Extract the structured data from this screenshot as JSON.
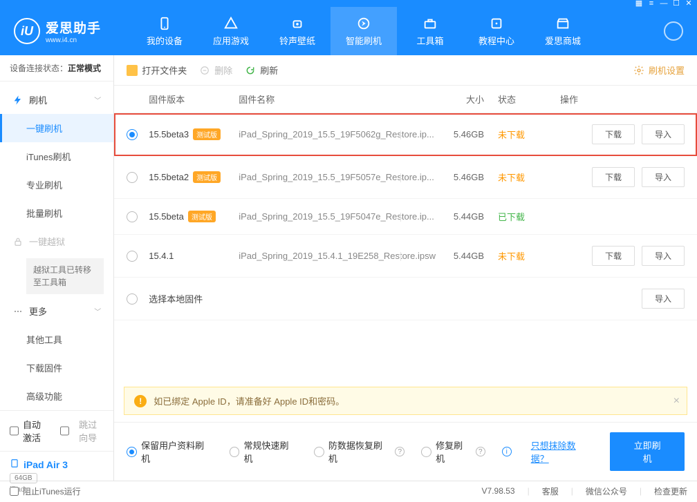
{
  "titlebar": {
    "icons": [
      "grid",
      "menu",
      "min",
      "max",
      "close"
    ]
  },
  "logo": {
    "title": "爱思助手",
    "sub": "www.i4.cn",
    "glyph": "iU"
  },
  "topnav": [
    {
      "id": "device",
      "label": "我的设备"
    },
    {
      "id": "apps",
      "label": "应用游戏"
    },
    {
      "id": "ringtone",
      "label": "铃声壁纸"
    },
    {
      "id": "flash",
      "label": "智能刷机",
      "active": true
    },
    {
      "id": "toolbox",
      "label": "工具箱"
    },
    {
      "id": "tutorial",
      "label": "教程中心"
    },
    {
      "id": "store",
      "label": "爱思商城"
    }
  ],
  "connection": {
    "label": "设备连接状态：",
    "value": "正常模式"
  },
  "sidebar": {
    "groups": [
      {
        "icon": "flash",
        "label": "刷机",
        "expanded": true,
        "items": [
          {
            "id": "oneclick",
            "label": "一键刷机",
            "selected": true
          },
          {
            "id": "itunes",
            "label": "iTunes刷机"
          },
          {
            "id": "pro",
            "label": "专业刷机"
          },
          {
            "id": "batch",
            "label": "批量刷机"
          }
        ]
      },
      {
        "icon": "lock",
        "label": "一键越狱",
        "disabled": true,
        "note": "越狱工具已转移至工具箱"
      },
      {
        "icon": "more",
        "label": "更多",
        "expanded": true,
        "items": [
          {
            "id": "othertools",
            "label": "其他工具"
          },
          {
            "id": "dlfw",
            "label": "下载固件"
          },
          {
            "id": "adv",
            "label": "高级功能"
          }
        ]
      }
    ],
    "autoActivate": {
      "label": "自动激活",
      "checked": false,
      "hint": "跳过向导",
      "hintChecked": false
    },
    "device": {
      "name": "iPad Air 3",
      "capacity": "64GB",
      "model": "iPad",
      "iconColor": "#1a8cff"
    }
  },
  "toolbar": {
    "openFolder": "打开文件夹",
    "delete": "删除",
    "refresh": "刷新",
    "settings": "刷机设置"
  },
  "table": {
    "headers": {
      "version": "固件版本",
      "name": "固件名称",
      "size": "大小",
      "status": "状态",
      "ops": "操作"
    },
    "rows": [
      {
        "selected": true,
        "highlight": true,
        "version": "15.5beta3",
        "beta": "测试版",
        "file": "iPad_Spring_2019_15.5_19F5062g_Restore.ip...",
        "size": "5.46GB",
        "status": "未下载",
        "statusClass": "nd",
        "download": "下载",
        "import": "导入"
      },
      {
        "selected": false,
        "version": "15.5beta2",
        "beta": "测试版",
        "file": "iPad_Spring_2019_15.5_19F5057e_Restore.ip...",
        "size": "5.46GB",
        "status": "未下载",
        "statusClass": "nd",
        "download": "下载",
        "import": "导入"
      },
      {
        "selected": false,
        "version": "15.5beta",
        "beta": "测试版",
        "file": "iPad_Spring_2019_15.5_19F5047e_Restore.ip...",
        "size": "5.44GB",
        "status": "已下载",
        "statusClass": "dl"
      },
      {
        "selected": false,
        "version": "15.4.1",
        "file": "iPad_Spring_2019_15.4.1_19E258_Restore.ipsw",
        "size": "5.44GB",
        "status": "未下载",
        "statusClass": "nd",
        "download": "下载",
        "import": "导入"
      },
      {
        "selected": false,
        "version": "选择本地固件",
        "localRow": true,
        "import": "导入"
      }
    ]
  },
  "notice": "如已绑定 Apple ID，请准备好 Apple ID和密码。",
  "flashOptions": [
    {
      "id": "keepdata",
      "label": "保留用户资料刷机",
      "checked": true
    },
    {
      "id": "quick",
      "label": "常规快速刷机"
    },
    {
      "id": "recover",
      "label": "防数据恢复刷机",
      "help": true
    },
    {
      "id": "repair",
      "label": "修复刷机",
      "help": true
    }
  ],
  "eraseLink": "只想抹除数据？",
  "flashButton": "立即刷机",
  "footer": {
    "blockItunes": "阻止iTunes运行",
    "version": "V7.98.53",
    "support": "客服",
    "wechat": "微信公众号",
    "update": "检查更新"
  }
}
